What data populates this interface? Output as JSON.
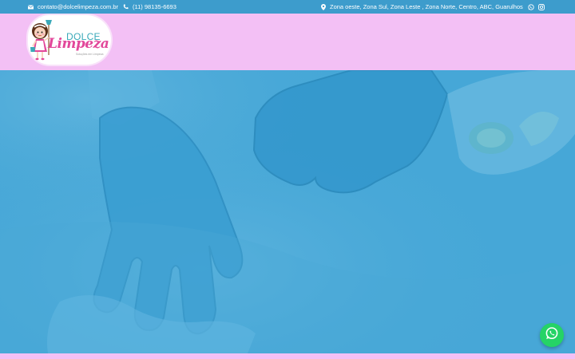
{
  "topbar": {
    "email": "contato@dolcelimpeza.com.br",
    "phone": "(11) 98135-6693",
    "location": "Zona oeste, Zona Sul, Zona Leste , Zona Norte, Centro, ABC, Guarulhos",
    "icons": {
      "email": "envelope-icon",
      "phone": "phone-icon",
      "location": "map-pin-icon",
      "whatsapp": "whatsapp-icon",
      "instagram": "instagram-icon"
    }
  },
  "header": {
    "logo": {
      "line1": "DOLCE",
      "line2": "Limpeza",
      "tagline": "Soluções em Limpeza"
    }
  },
  "hero": {
    "image": "cleaning-gloves-hero-image"
  },
  "floating": {
    "whatsapp_button": "whatsapp-chat-icon"
  },
  "colors": {
    "topbar": "#3d9ccc",
    "header": "#f3c0f5",
    "hero_overlay": "#45a6d6",
    "logo_teal": "#3aa9b9",
    "logo_pink": "#e2479a",
    "whatsapp": "#25d366"
  }
}
